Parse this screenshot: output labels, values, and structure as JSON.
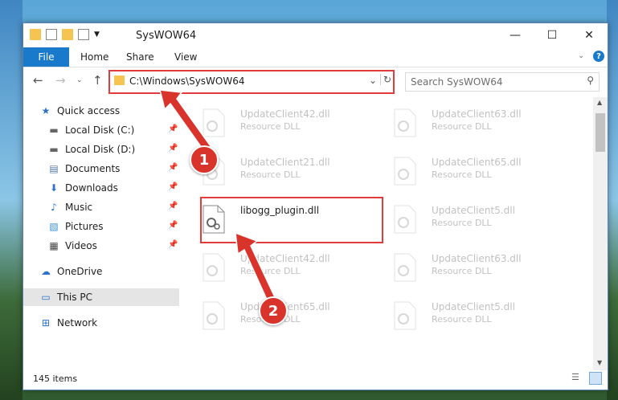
{
  "window": {
    "title": "SysWOW64"
  },
  "ribbon": {
    "tabs": [
      "File",
      "Home",
      "Share",
      "View"
    ]
  },
  "address": {
    "path": "C:\\Windows\\SysWOW64"
  },
  "search": {
    "placeholder": "Search SysWOW64"
  },
  "nav": {
    "items": [
      {
        "label": "Quick access",
        "icon": "star-icon"
      },
      {
        "label": "Local Disk (C:)",
        "icon": "drive-icon"
      },
      {
        "label": "Local Disk (D:)",
        "icon": "drive-icon"
      },
      {
        "label": "Documents",
        "icon": "documents-icon"
      },
      {
        "label": "Downloads",
        "icon": "downloads-icon"
      },
      {
        "label": "Music",
        "icon": "music-icon"
      },
      {
        "label": "Pictures",
        "icon": "pictures-icon"
      },
      {
        "label": "Videos",
        "icon": "videos-icon"
      },
      {
        "label": "OneDrive",
        "icon": "cloud-icon"
      },
      {
        "label": "This PC",
        "icon": "pc-icon"
      },
      {
        "label": "Network",
        "icon": "network-icon"
      }
    ]
  },
  "files": [
    {
      "name": "UpdateClient42.dll",
      "type": "Resource DLL"
    },
    {
      "name": "UpdateClient63.dll",
      "type": "Resource DLL"
    },
    {
      "name": "UpdateClient21.dll",
      "type": "Resource DLL"
    },
    {
      "name": "UpdateClient65.dll",
      "type": "Resource DLL"
    },
    {
      "name": "libogg_plugin.dll",
      "type": ""
    },
    {
      "name": "UpdateClient5.dll",
      "type": "Resource DLL"
    },
    {
      "name": "UpdateClient42.dll",
      "type": "Resource DLL"
    },
    {
      "name": "UpdateClient63.dll",
      "type": "Resource DLL"
    },
    {
      "name": "UpdateClient65.dll",
      "type": "Resource DLL"
    },
    {
      "name": "UpdateClient5.dll",
      "type": "Resource DLL"
    }
  ],
  "status": {
    "count": "145 items"
  },
  "badges": {
    "one": "1",
    "two": "2"
  },
  "colors": {
    "accent": "#1979ca",
    "highlight": "#e23b3b"
  }
}
